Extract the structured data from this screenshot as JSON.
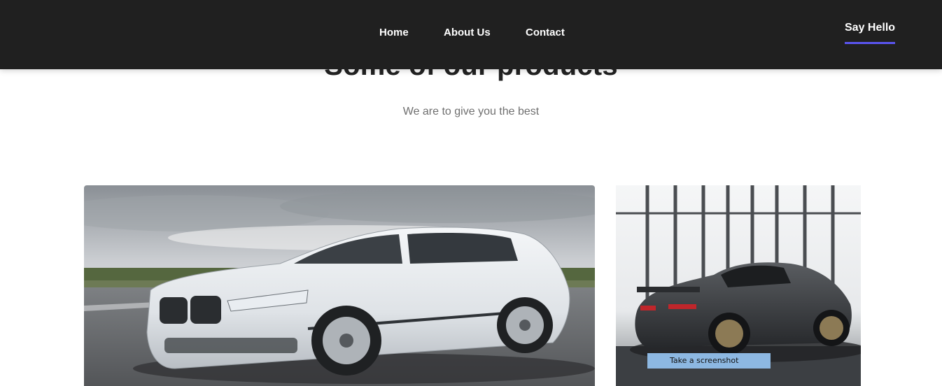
{
  "nav": {
    "home": "Home",
    "about": "About Us",
    "contact": "Contact"
  },
  "cta": {
    "label": "Say Hello"
  },
  "section": {
    "title": "Some of our products",
    "subtitle": "We are to give you the best"
  },
  "products": [
    {
      "image": "white-sedan-image"
    },
    {
      "image": "dark-sports-car-image"
    }
  ],
  "tooltip": {
    "label": "Take a screenshot"
  },
  "colors": {
    "header_bg": "#202020",
    "accent": "#5a55f0",
    "text": "#222222",
    "muted": "#6f6f6f"
  }
}
